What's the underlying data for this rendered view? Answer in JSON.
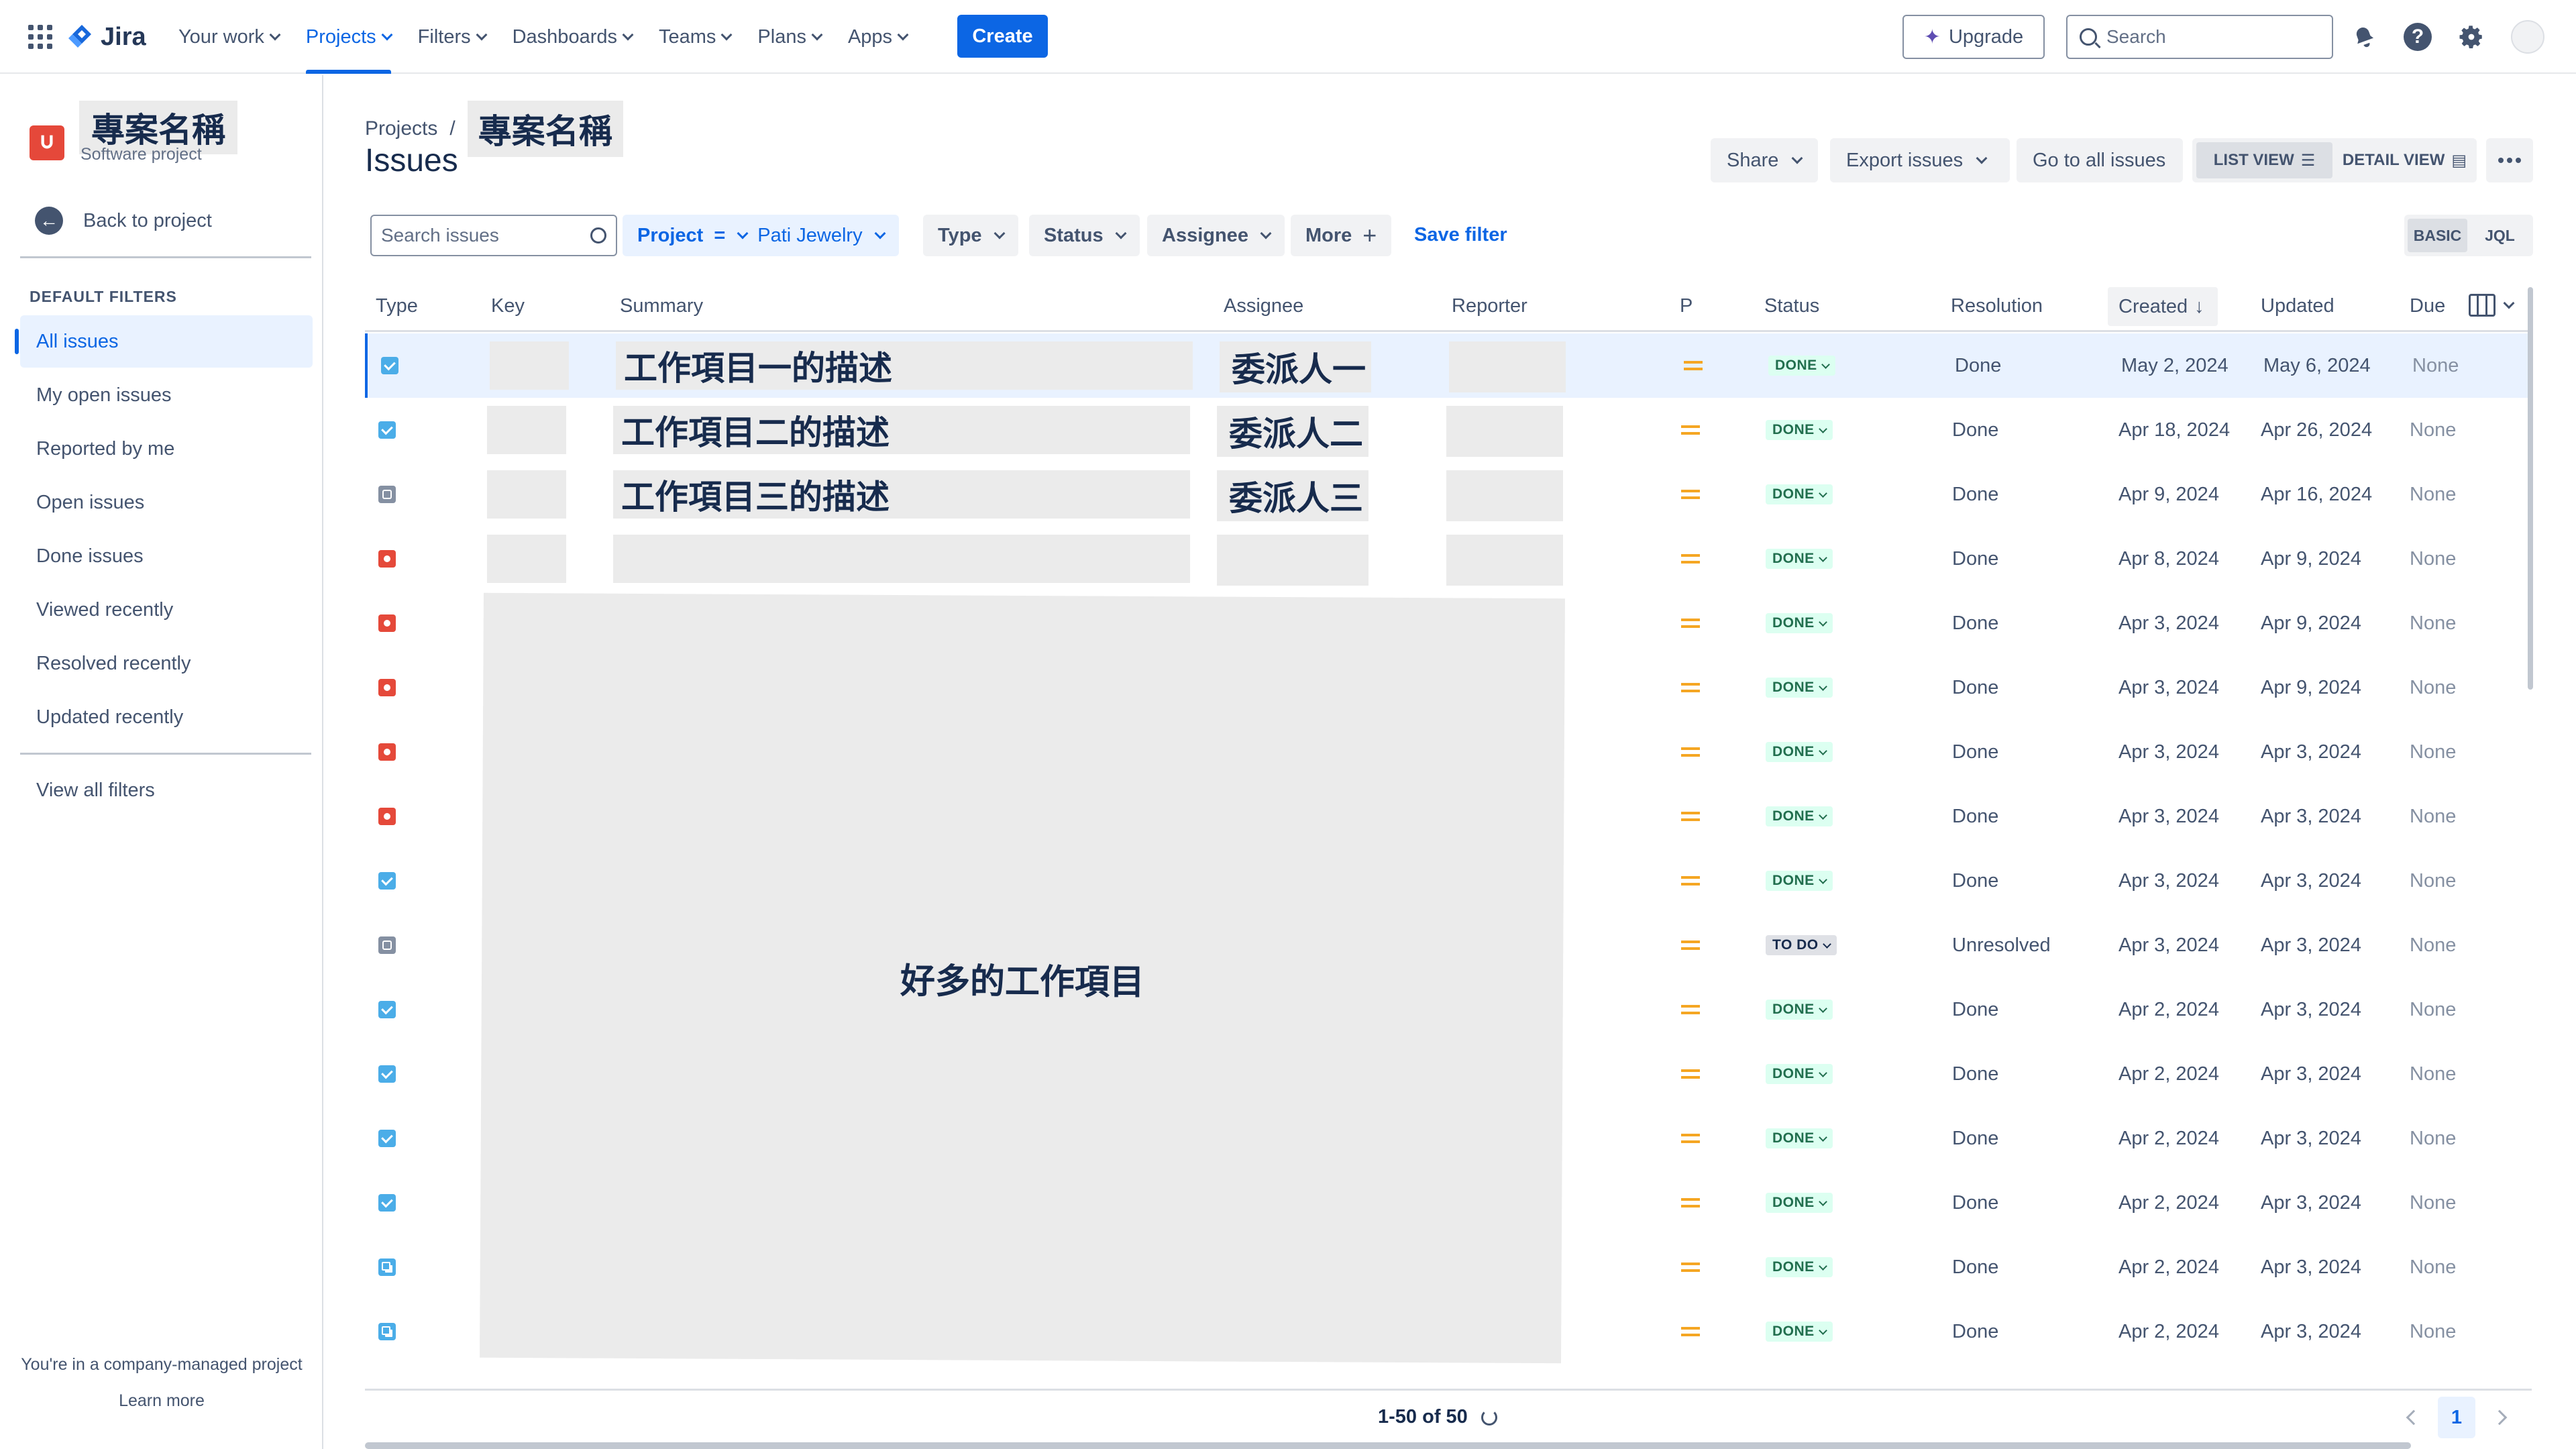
{
  "topnav": {
    "logo": "Jira",
    "items": [
      {
        "label": "Your work"
      },
      {
        "label": "Projects"
      },
      {
        "label": "Filters"
      },
      {
        "label": "Dashboards"
      },
      {
        "label": "Teams"
      },
      {
        "label": "Plans"
      },
      {
        "label": "Apps"
      }
    ],
    "active_item": "Projects",
    "create_label": "Create",
    "upgrade_label": "Upgrade",
    "search_placeholder": "Search",
    "accent": "#0c66e4"
  },
  "sidebar": {
    "project_name": "專案名稱",
    "project_type": "Software project",
    "back_label": "Back to project",
    "heading": "DEFAULT FILTERS",
    "items": [
      {
        "label": "All issues"
      },
      {
        "label": "My open issues"
      },
      {
        "label": "Reported by me"
      },
      {
        "label": "Open issues"
      },
      {
        "label": "Done issues"
      },
      {
        "label": "Viewed recently"
      },
      {
        "label": "Resolved recently"
      },
      {
        "label": "Updated recently"
      }
    ],
    "active_item": "All issues",
    "view_all": "View all filters",
    "footer_text": "You're in a company-managed project",
    "learn_more": "Learn more"
  },
  "header": {
    "breadcrumb_root": "Projects",
    "breadcrumb_sep": "/",
    "breadcrumb_project": "專案名稱",
    "title": "Issues",
    "share": "Share",
    "export": "Export issues",
    "go_all": "Go to all issues",
    "list_view": "LIST VIEW",
    "detail_view": "DETAIL VIEW"
  },
  "filters": {
    "search_placeholder": "Search issues",
    "project_label": "Project",
    "project_op": "=",
    "project_value": "Pati Jewelry",
    "type": "Type",
    "status": "Status",
    "assignee": "Assignee",
    "more": "More",
    "save": "Save filter",
    "basic": "BASIC",
    "jql": "JQL"
  },
  "table": {
    "columns": {
      "type": "Type",
      "key": "Key",
      "summary": "Summary",
      "assignee": "Assignee",
      "reporter": "Reporter",
      "p": "P",
      "status": "Status",
      "resolution": "Resolution",
      "created": "Created",
      "updated": "Updated",
      "due": "Due"
    },
    "placeholder_many": "好多的工作項目",
    "rows": [
      {
        "type": "task",
        "summary": "工作項目一的描述",
        "assignee": "委派人一",
        "status": "DONE",
        "resolution": "Done",
        "created": "May 2, 2024",
        "updated": "May 6, 2024",
        "due": "None"
      },
      {
        "type": "task",
        "summary": "工作項目二的描述",
        "assignee": "委派人二",
        "status": "DONE",
        "resolution": "Done",
        "created": "Apr 18, 2024",
        "updated": "Apr 26, 2024",
        "due": "None"
      },
      {
        "type": "sub",
        "summary": "工作項目三的描述",
        "assignee": "委派人三",
        "status": "DONE",
        "resolution": "Done",
        "created": "Apr 9, 2024",
        "updated": "Apr 16, 2024",
        "due": "None"
      },
      {
        "type": "bug",
        "summary": "",
        "assignee": "",
        "status": "DONE",
        "resolution": "Done",
        "created": "Apr 8, 2024",
        "updated": "Apr 9, 2024",
        "due": "None"
      },
      {
        "type": "bug",
        "status": "DONE",
        "resolution": "Done",
        "created": "Apr 3, 2024",
        "updated": "Apr 9, 2024",
        "due": "None"
      },
      {
        "type": "bug",
        "status": "DONE",
        "resolution": "Done",
        "created": "Apr 3, 2024",
        "updated": "Apr 9, 2024",
        "due": "None"
      },
      {
        "type": "bug",
        "status": "DONE",
        "resolution": "Done",
        "created": "Apr 3, 2024",
        "updated": "Apr 3, 2024",
        "due": "None"
      },
      {
        "type": "bug",
        "status": "DONE",
        "resolution": "Done",
        "created": "Apr 3, 2024",
        "updated": "Apr 3, 2024",
        "due": "None"
      },
      {
        "type": "task",
        "status": "DONE",
        "resolution": "Done",
        "created": "Apr 3, 2024",
        "updated": "Apr 3, 2024",
        "due": "None"
      },
      {
        "type": "sub",
        "status": "TO DO",
        "resolution": "Unresolved",
        "created": "Apr 3, 2024",
        "updated": "Apr 3, 2024",
        "due": "None"
      },
      {
        "type": "task",
        "status": "DONE",
        "resolution": "Done",
        "created": "Apr 2, 2024",
        "updated": "Apr 3, 2024",
        "due": "None"
      },
      {
        "type": "task",
        "status": "DONE",
        "resolution": "Done",
        "created": "Apr 2, 2024",
        "updated": "Apr 3, 2024",
        "due": "None"
      },
      {
        "type": "task",
        "status": "DONE",
        "resolution": "Done",
        "created": "Apr 2, 2024",
        "updated": "Apr 3, 2024",
        "due": "None"
      },
      {
        "type": "task",
        "status": "DONE",
        "resolution": "Done",
        "created": "Apr 2, 2024",
        "updated": "Apr 3, 2024",
        "due": "None"
      },
      {
        "type": "story",
        "status": "DONE",
        "resolution": "Done",
        "created": "Apr 2, 2024",
        "updated": "Apr 3, 2024",
        "due": "None"
      },
      {
        "type": "story",
        "status": "DONE",
        "resolution": "Done",
        "created": "Apr 2, 2024",
        "updated": "Apr 3, 2024",
        "due": "None"
      }
    ]
  },
  "pagination": {
    "count": "1-50 of 50",
    "page": "1"
  }
}
